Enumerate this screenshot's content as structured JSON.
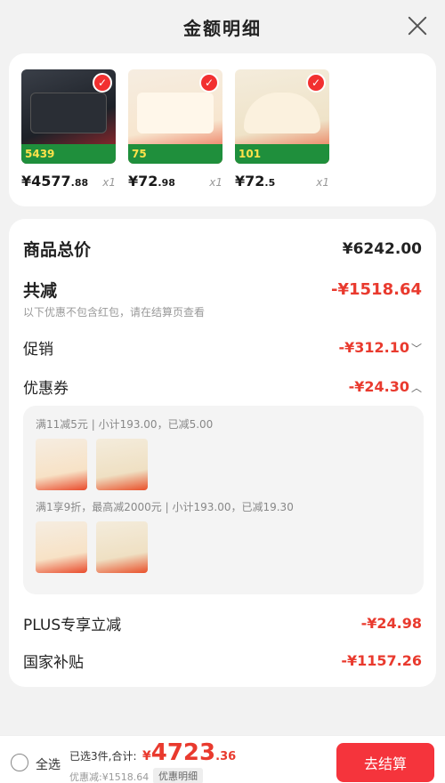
{
  "header": {
    "title": "金额明细"
  },
  "products": [
    {
      "price_int": "¥4577",
      "price_dec": ".88",
      "qty": "x1",
      "badge": "5439"
    },
    {
      "price_int": "¥72",
      "price_dec": ".98",
      "qty": "x1",
      "badge": "75"
    },
    {
      "price_int": "¥72",
      "price_dec": ".5",
      "qty": "x1",
      "badge": "101"
    }
  ],
  "details": {
    "goods_total_label": "商品总价",
    "goods_total_value": "¥6242.00",
    "discount_label": "共减",
    "discount_value": "-¥1518.64",
    "discount_note": "以下优惠不包含红包，请在结算页查看",
    "promo_label": "促销",
    "promo_value": "-¥312.10",
    "coupon_label": "优惠券",
    "coupon_value": "-¥24.30",
    "coupon_lines": [
      "满11减5元 | 小计193.00，已减5.00",
      "满1享9折，最高减2000元 | 小计193.00，已减19.30"
    ],
    "plus_label": "PLUS专享立减",
    "plus_value": "-¥24.98",
    "subsidy_label": "国家补贴",
    "subsidy_value": "-¥1157.26"
  },
  "footer": {
    "select_all": "全选",
    "summary": "已选3件,合计:",
    "total_cur": "¥",
    "total_int": "4723",
    "total_dec": ".36",
    "discounted": "优惠减:¥1518.64",
    "detail_pill": "优惠明细",
    "checkout": "去结算"
  },
  "colors": {
    "accent": "#f5343c",
    "discount_red": "#e93a2e",
    "green_badge": "#1f8f3c"
  }
}
